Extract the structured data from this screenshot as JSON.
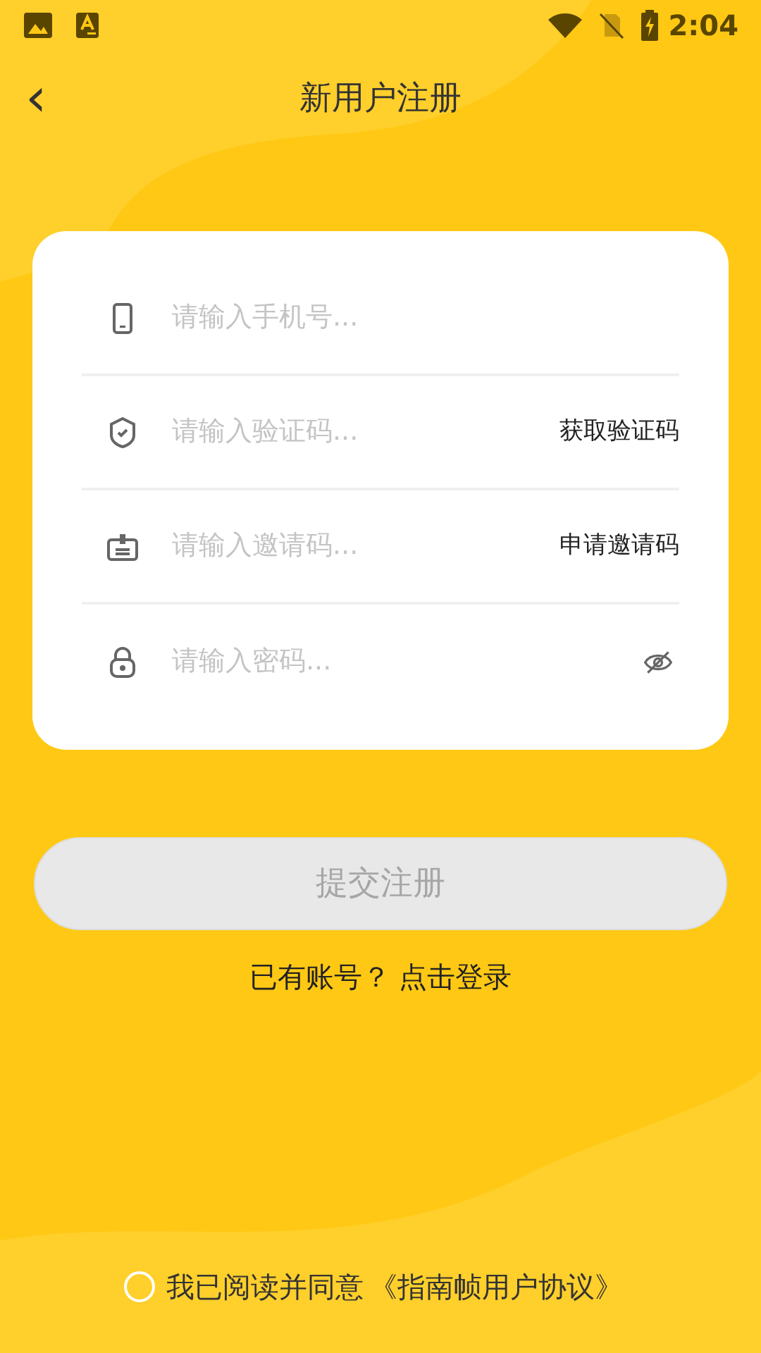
{
  "status_bar": {
    "time": "2:04"
  },
  "header": {
    "back": "‹",
    "title": "新用户注册"
  },
  "form": {
    "fields": [
      {
        "kind": "phone",
        "placeholder": "请输入手机号..."
      },
      {
        "kind": "code",
        "placeholder": "请输入验证码...",
        "action": "获取验证码"
      },
      {
        "kind": "invite",
        "placeholder": "请输入邀请码...",
        "action": "申请邀请码"
      },
      {
        "kind": "password",
        "placeholder": "请输入密码...",
        "password_visible": false
      }
    ]
  },
  "submit": {
    "label": "提交注册",
    "disabled": true
  },
  "login_link": "已有账号？ 点击登录",
  "agreement": {
    "checked": false,
    "text": "我已阅读并同意",
    "link": "《指南帧用户协议》"
  }
}
